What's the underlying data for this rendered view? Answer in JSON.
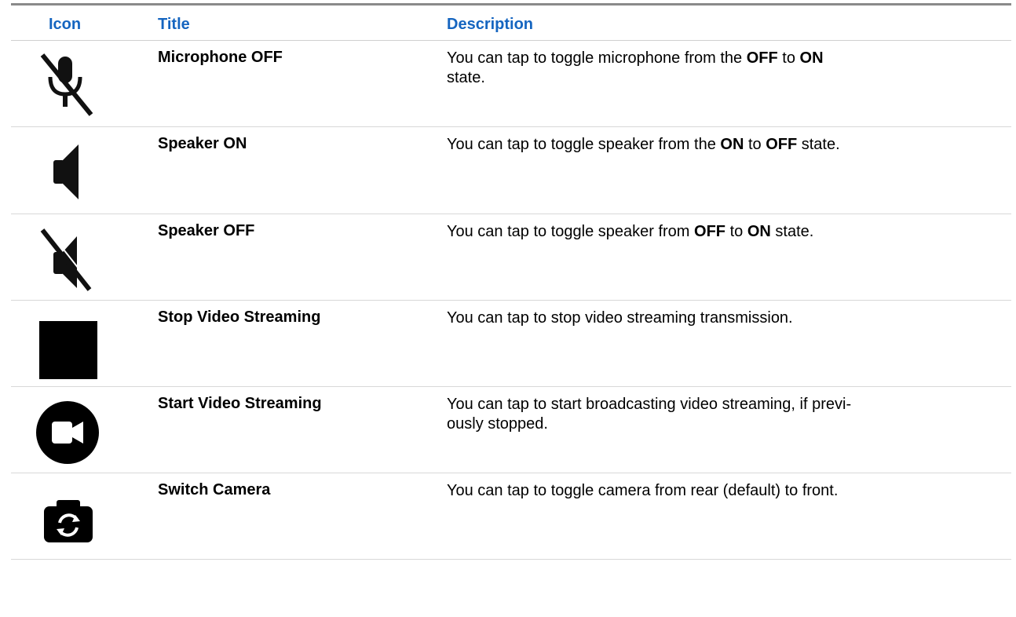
{
  "header": {
    "icon": "Icon",
    "title": "Title",
    "description": "Description"
  },
  "colors": {
    "header_text": "#1565c0",
    "rule_top": "#8a8a8a",
    "rule_row": "#d8d8d8"
  },
  "rows": [
    {
      "icon": "microphone-off-icon",
      "title": "Microphone OFF",
      "desc": {
        "a": "You can tap to toggle microphone from the ",
        "b": "OFF",
        "c": " to ",
        "d": "ON",
        "e": "\nstate."
      }
    },
    {
      "icon": "speaker-on-icon",
      "title": "Speaker ON",
      "desc": {
        "a": "You can tap to toggle speaker from the ",
        "b": "ON",
        "c": " to ",
        "d": "OFF",
        "e": " state."
      }
    },
    {
      "icon": "speaker-off-icon",
      "title": "Speaker OFF",
      "desc": {
        "a": "You can tap to toggle speaker from ",
        "b": "OFF",
        "c": " to ",
        "d": "ON",
        "e": " state."
      }
    },
    {
      "icon": "stop-square-icon",
      "title": "Stop Video Streaming",
      "desc": "You can tap to stop video streaming transmission."
    },
    {
      "icon": "video-camera-icon",
      "title": "Start Video Streaming",
      "desc": "You can tap to start broadcasting video streaming, if previ-\nously stopped."
    },
    {
      "icon": "switch-camera-icon",
      "title": "Switch Camera",
      "desc": "You can tap to toggle camera from rear (default) to front."
    }
  ]
}
